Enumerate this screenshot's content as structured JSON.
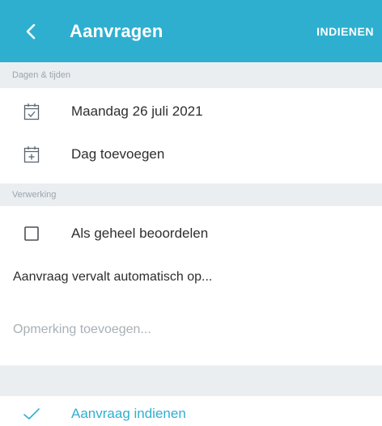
{
  "header": {
    "title": "Aanvragen",
    "submit_label": "INDIENEN",
    "color": "#2fafd0"
  },
  "sections": {
    "dates": {
      "header": "Dagen & tijden",
      "items": [
        {
          "icon": "calendar-check-icon",
          "label": "Maandag 26 juli 2021"
        },
        {
          "icon": "calendar-add-icon",
          "label": "Dag toevoegen"
        }
      ]
    },
    "processing": {
      "header": "Verwerking",
      "checkbox_label": "Als geheel beoordelen",
      "checkbox_checked": false,
      "expiry_label": "Aanvraag vervalt automatisch op...",
      "remark_placeholder": "Opmerking toevoegen..."
    }
  },
  "footer": {
    "confirm_label": "Aanvraag indienen",
    "confirm_icon": "checkmark-icon"
  }
}
